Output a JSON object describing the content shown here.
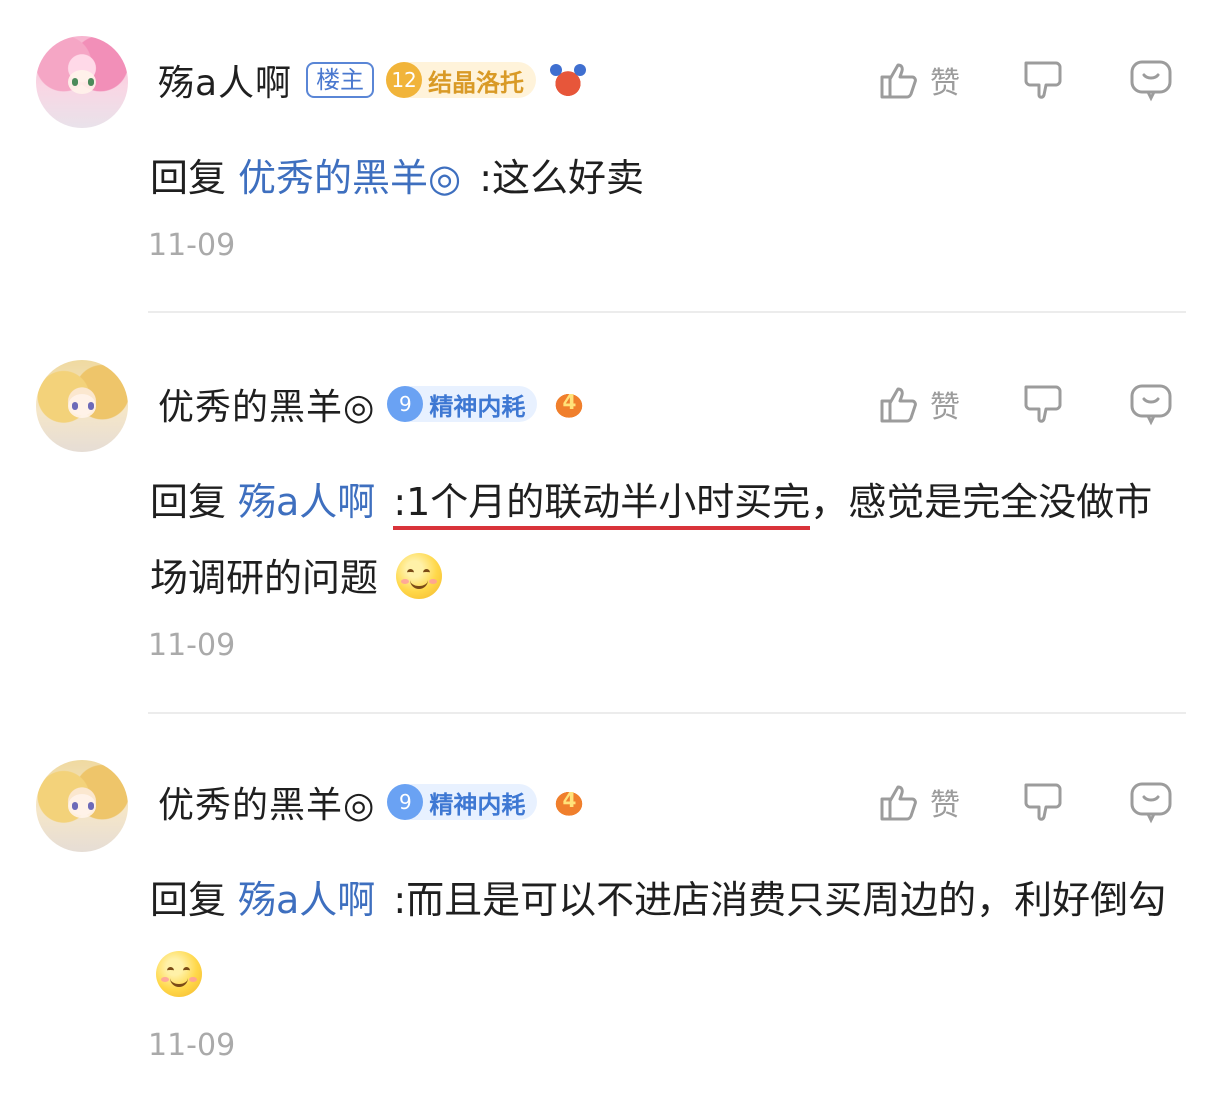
{
  "comments": [
    {
      "username": "殇a人啊",
      "owner_badge": "楼主",
      "level_number": "12",
      "level_title": "结晶洛托",
      "like_label": "赞",
      "reply_word": "回复",
      "mention": "优秀的黑羊◎",
      "body": ":这么好卖",
      "time": "11-09"
    },
    {
      "username": "优秀的黑羊◎",
      "level_number": "9",
      "level_title": "精神内耗",
      "medal_number": "4",
      "like_label": "赞",
      "reply_word": "回复",
      "mention": "殇a人啊",
      "body_underlined": ":1个月的联动半小时买完",
      "body_rest": "，感觉是完全没做市场调研的问题",
      "time": "11-09"
    },
    {
      "username": "优秀的黑羊◎",
      "level_number": "9",
      "level_title": "精神内耗",
      "medal_number": "4",
      "like_label": "赞",
      "reply_word": "回复",
      "mention": "殇a人啊",
      "body": ":而且是可以不进店消费只买周边的，利好倒勾",
      "time": "11-09"
    }
  ],
  "icons": {
    "like": "thumbs-up-icon",
    "dislike": "thumbs-down-icon",
    "reply": "comment-bubble-icon",
    "emoji": "smile-emoji-icon",
    "medal_crab": "crab-medal-icon",
    "medal_wings": "wings-medal-icon"
  },
  "colors": {
    "mention": "#3e6fbf",
    "underline": "#d9333a",
    "timestamp": "#aaaaaa",
    "owner_badge": "#4a78cf",
    "level_gold": "#d99a26",
    "level_blue": "#3e78d3"
  }
}
